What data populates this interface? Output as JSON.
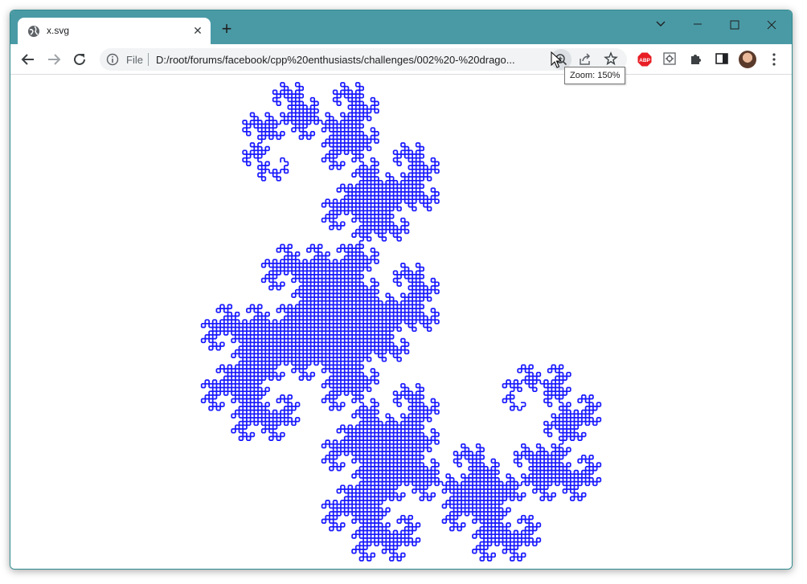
{
  "window": {
    "tab": {
      "title": "x.svg"
    },
    "icons": {
      "tab_favicon": "globe-icon",
      "close_tab": "close-icon",
      "new_tab": "plus-icon",
      "minimize": "minimize-icon",
      "maximize": "maximize-icon",
      "close": "close-window-icon",
      "tab_search": "chevron-down-icon"
    },
    "accent": "#4a9aa6"
  },
  "toolbar": {
    "omnibox": {
      "scheme_label": "File",
      "url": "D:/root/forums/facebook/cpp%20enthusiasts/challenges/002%20-%20drago..."
    },
    "zoom_tooltip": "Zoom: 150%",
    "extensions": [
      "abp-icon",
      "settings-extension-icon",
      "puzzle-icon",
      "side-panel-icon"
    ]
  },
  "content": {
    "stroke_color": "#1a1aff",
    "shape": "dragon-curve"
  }
}
